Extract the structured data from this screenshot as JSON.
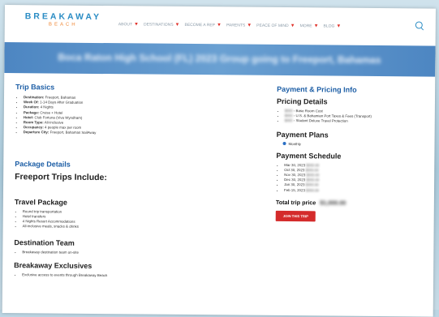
{
  "brand": {
    "name": "BREAKAWAY",
    "sub": "BEACH"
  },
  "nav": [
    {
      "label": "ABOUT",
      "caret": "▼"
    },
    {
      "label": "DESTINATIONS",
      "caret": "▼"
    },
    {
      "label": "BECOME A REP",
      "caret": "▼"
    },
    {
      "label": "PARENTS",
      "caret": "▼"
    },
    {
      "label": "PEACE OF MIND",
      "caret": "▼"
    },
    {
      "label": "MORE",
      "caret": "▼"
    },
    {
      "label": "BLOG",
      "caret": "▼"
    }
  ],
  "hero": {
    "title": "Boca Raton High School (FL) 2023 Group going to Freeport, Bahamas"
  },
  "trip_basics": {
    "heading": "Trip Basics",
    "items": [
      {
        "label": "Destination:",
        "value": "Freeport, Bahamas"
      },
      {
        "label": "Week Of:",
        "value": "1-14 Days After Graduation"
      },
      {
        "label": "Duration:",
        "value": "4 Nights"
      },
      {
        "label": "Package:",
        "value": "Cruise + Hotel"
      },
      {
        "label": "Hotel:",
        "value": "Club Fortuna (Viva Wyndham)"
      },
      {
        "label": "Room Type:",
        "value": "All-Inclusive"
      },
      {
        "label": "Occupancy:",
        "value": "4 people max per room"
      },
      {
        "label": "Departure City:",
        "value": "Freeport, Bahamas SailAway"
      }
    ]
  },
  "package_details": {
    "heading": "Package Details",
    "subheading": "Freeport Trips Include:"
  },
  "travel_package": {
    "heading": "Travel Package",
    "items": [
      "Round trip transportation",
      "Hotel transfers",
      "4 Nights Resort Accommodations",
      "All-inclusive meals, snacks & drinks"
    ]
  },
  "destination_team": {
    "heading": "Destination Team",
    "items": [
      "Breakaway destination team on-site"
    ]
  },
  "exclusives": {
    "heading": "Breakaway Exclusives",
    "items": [
      "Exclusive access to events through Breakaway Beach"
    ]
  },
  "payment": {
    "heading": "Payment & Pricing Info",
    "pricing_heading": "Pricing Details",
    "pricing_items": [
      {
        "amount": "$000",
        "text": "- Base Room Cost"
      },
      {
        "amount": "$000",
        "text": "- U.S. & Bahamian Port Taxes & Fees (Transport)"
      },
      {
        "amount": "$000",
        "text": "- Student Deluxe Travel Protection"
      }
    ],
    "plans_heading": "Payment Plans",
    "plan_option": "Monthly",
    "schedule_heading": "Payment Schedule",
    "schedule": [
      {
        "date": "Mar 30, 2023",
        "amount": "$000.00"
      },
      {
        "date": "Oct 30, 2023",
        "amount": "$000.00"
      },
      {
        "date": "Nov 30, 2023",
        "amount": "$000.00"
      },
      {
        "date": "Dec 30, 2023",
        "amount": "$000.00"
      },
      {
        "date": "Jan 30, 2023",
        "amount": "$000.00"
      },
      {
        "date": "Feb 15, 2023",
        "amount": "$000.00"
      }
    ],
    "total_label": "Total trip price",
    "total_value": "$1,000.00",
    "cta_label": "JOIN THIS TRIP"
  },
  "colors": {
    "brand_blue": "#2a8cc4",
    "brand_orange": "#f08a3a",
    "heading_blue": "#1e5fa6",
    "cta_red": "#d42b2b"
  }
}
